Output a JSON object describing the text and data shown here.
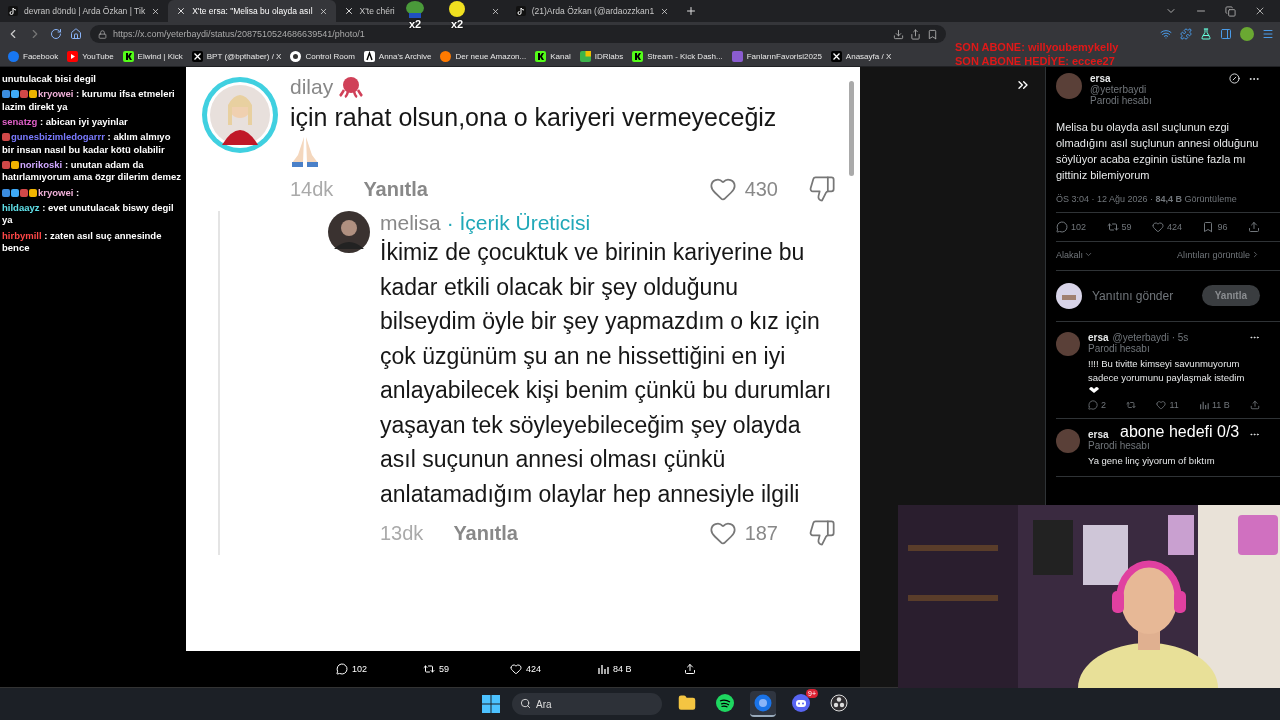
{
  "tabs": [
    {
      "title": "devran döndü | Arda Özkan | Tik",
      "kind": "tiktok",
      "selected": false
    },
    {
      "title": "X'te ersa: \"Melisa bu olayda asıl",
      "kind": "x",
      "selected": true
    },
    {
      "title": "X'te chéri",
      "kind": "x",
      "selected": false
    },
    {
      "title": "(21)Arda Özkan (@ardaozzkan1",
      "kind": "tiktok",
      "selected": false
    }
  ],
  "address_bar": {
    "url": "https://x.com/yeterbaydi/status/2087510524686639541/photo/1"
  },
  "bookmarks": [
    {
      "label": "Facebook",
      "kind": "facebook"
    },
    {
      "label": "YouTube",
      "kind": "youtube"
    },
    {
      "label": "Elwind | Kick",
      "kind": "kick"
    },
    {
      "label": "BPT (@bpthaber) / X",
      "kind": "x"
    },
    {
      "label": "Control Room",
      "kind": "control"
    },
    {
      "label": "Anna's Archive",
      "kind": "annas"
    },
    {
      "label": "Der neue Amazon...",
      "kind": "amazon"
    },
    {
      "label": "Kanal",
      "kind": "kick"
    },
    {
      "label": "IDRlabs",
      "kind": "idr"
    },
    {
      "label": "Stream - Kick Dash...",
      "kind": "kick"
    },
    {
      "label": "FanlarınFavorisi2025",
      "kind": "fanlar"
    },
    {
      "label": "Anasayfa / X",
      "kind": "x"
    }
  ],
  "stream_overlay": {
    "emote_counts": [
      "x2",
      "x2"
    ],
    "last_sub": "SON ABONE: willyoubemykelly",
    "last_gift": "SON ABONE HEDİYE: eccee27",
    "goal": "abone hedefi 0/3"
  },
  "chat": [
    {
      "message": "unutulacak bisi degil"
    },
    {
      "user": "kryowei",
      "color": "#f0b0d8",
      "badges": [
        {
          "color": "#3b8de0"
        },
        {
          "color": "#3fa9f5"
        },
        {
          "color": "#d04848"
        },
        {
          "color": "#f0b400"
        }
      ],
      "message": ": kurumu ifsa etmeleri lazim direkt ya"
    },
    {
      "user": "senatzg",
      "color": "#e060c8",
      "message": ": abican iyi yayinlar"
    },
    {
      "user": "gunesbizimledogarrr",
      "color": "#7a7aff",
      "badges": [
        {
          "color": "#d04848"
        }
      ],
      "message": ": aklım almıyo bir insan nasıl bu kadar kötü olabilir"
    },
    {
      "user": "norikoski",
      "color": "#d0a8ff",
      "badges": [
        {
          "color": "#d04848"
        },
        {
          "color": "#f0b400"
        }
      ],
      "message": ": unutan adam da hatırlamıyorum ama özgr dilerim demez"
    },
    {
      "user": "kryowei",
      "color": "#f0b0d8",
      "badges": [
        {
          "color": "#3b8de0"
        },
        {
          "color": "#3fa9f5"
        },
        {
          "color": "#d04848"
        },
        {
          "color": "#f0b400"
        }
      ],
      "message": ":"
    },
    {
      "user": "hildaayz",
      "color": "#60e0e8",
      "message": ": evet unutulacak biswy degil ya"
    },
    {
      "user": "hirbymill",
      "color": "#ff4848",
      "message": ": zaten asıl suç annesinde bence"
    }
  ],
  "comments": [
    {
      "user": "dilay",
      "text": "için rahat olsun,ona o kariyeri vermeyeceğiz",
      "time": "14dk",
      "reply": "Yanıtla",
      "likes": "430"
    },
    {
      "user": "melisa",
      "creator_tag": "· İçerik Üreticisi",
      "text": "İkimiz de çocuktuk ve birinin kariyerine bu kadar etkili olacak bir şey olduğunu bilseydim öyle bir şey yapmazdım o kız için çok üzgünüm şu an ne hissettiğini en iyi anlayabilecek kişi benim çünkü bu durumları yaşayan tek söyleyebileceğim şey olayda asıl suçunun annesi olması çünkü anlatamadığım olaylar hep annesiyle ilgili",
      "time": "13dk",
      "reply": "Yanıtla",
      "likes": "187"
    }
  ],
  "photo_actions": [
    {
      "kind": "reply",
      "count": "102"
    },
    {
      "kind": "repost",
      "count": "59"
    },
    {
      "kind": "like",
      "count": "424"
    },
    {
      "kind": "views",
      "count": "84 B"
    },
    {
      "kind": "share"
    }
  ],
  "tweet": {
    "author": "ersa",
    "handle": "@yeterbaydi",
    "badge": "Parodi hesabı",
    "text": "Melisa bu olayda asıl suçlunun ezgi olmadığını asıl suçlunun annesi olduğunu söylüyor acaba ezginin üstüne fazla mı gittiniz bilemiyorum",
    "meta": "ÖS 3:04 · 12 Ağu 2026 · **84,4 B** Görüntüleme",
    "stats": [
      {
        "kind": "reply",
        "count": "102"
      },
      {
        "kind": "repost",
        "count": "59"
      },
      {
        "kind": "like",
        "count": "424"
      },
      {
        "kind": "bookmark",
        "count": "96"
      },
      {
        "kind": "share"
      }
    ],
    "sort": "Alakalı",
    "quotes": "Alıntıları görüntüle",
    "reply_placeholder": "Yanıtını gönder",
    "reply_button": "Yanıtla",
    "reply_button_disabled": true
  },
  "replies": [
    {
      "author": "ersa",
      "handle": "@yeterbaydi · 5s",
      "badge": "Parodi hesabı",
      "text": "!!!! Bu tivitte kimseyi savunmuyorum sadece yorumunu paylaşmak istedim",
      "stats": [
        {
          "kind": "reply",
          "count": "2"
        },
        {
          "kind": "repost"
        },
        {
          "kind": "like",
          "count": "11"
        },
        {
          "kind": "views",
          "count": "11 B"
        },
        {
          "kind": "share"
        }
      ]
    },
    {
      "author": "ersa",
      "badge": "Parodi hesabı",
      "text": "Ya gene linç yiyorum of bıktım"
    }
  ],
  "taskbar": {
    "search_placeholder": "Ara",
    "apps": [
      {
        "kind": "folder",
        "selected": false
      },
      {
        "kind": "spotify",
        "selected": false
      },
      {
        "kind": "browser",
        "selected": true
      },
      {
        "kind": "discord",
        "selected": false,
        "badge": "9+"
      },
      {
        "kind": "obs",
        "selected": false
      }
    ]
  }
}
